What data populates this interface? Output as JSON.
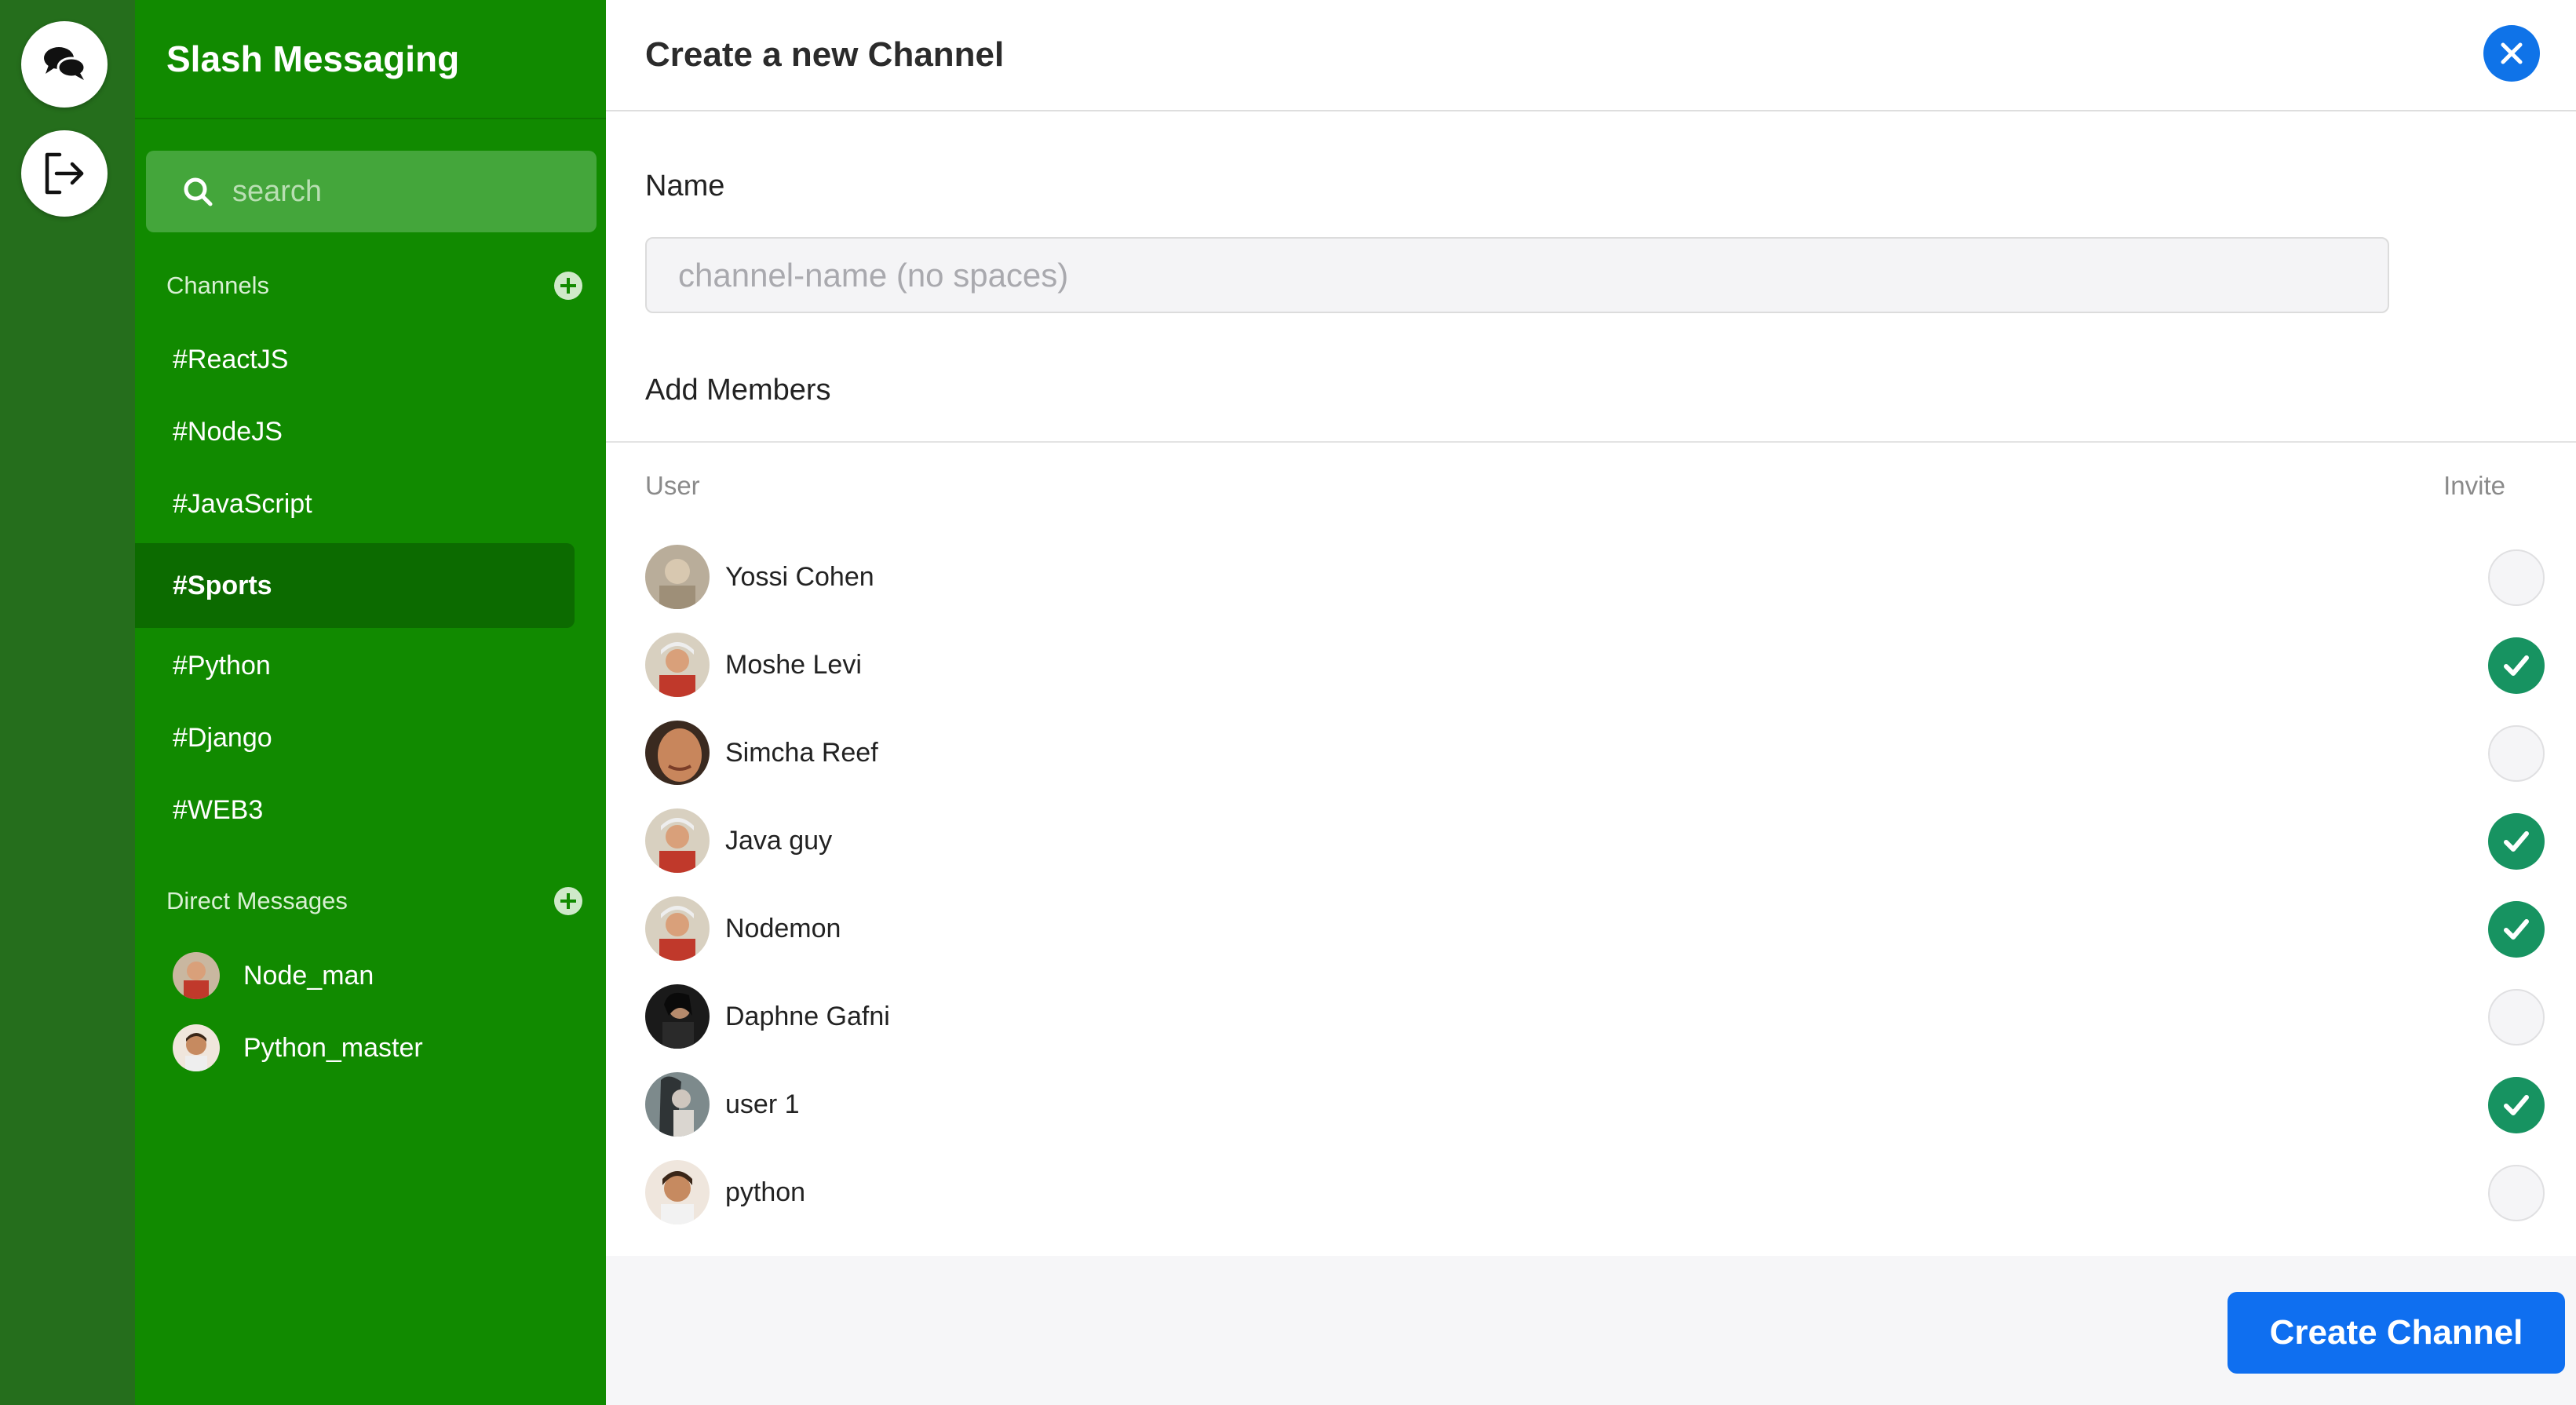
{
  "app": {
    "title": "Slash Messaging"
  },
  "rail": {
    "chat_icon": "chat-bubbles-icon",
    "logout_icon": "logout-icon"
  },
  "search": {
    "placeholder": "search"
  },
  "channels": {
    "heading": "Channels",
    "items": [
      {
        "label": "#ReactJS",
        "active": false
      },
      {
        "label": "#NodeJS",
        "active": false
      },
      {
        "label": "#JavaScript",
        "active": false
      },
      {
        "label": "#Sports",
        "active": true
      },
      {
        "label": "#Python",
        "active": false
      },
      {
        "label": "#Django",
        "active": false
      },
      {
        "label": "#WEB3",
        "active": false
      }
    ]
  },
  "direct_messages": {
    "heading": "Direct Messages",
    "items": [
      {
        "label": "Node_man"
      },
      {
        "label": "Python_master"
      }
    ]
  },
  "modal": {
    "title": "Create a new Channel",
    "name_label": "Name",
    "name_placeholder": "channel-name (no spaces)",
    "name_value": "",
    "members_label": "Add Members",
    "col_user": "User",
    "col_invite": "Invite",
    "members": [
      {
        "name": "Yossi Cohen",
        "invited": false
      },
      {
        "name": "Moshe Levi",
        "invited": true
      },
      {
        "name": "Simcha Reef",
        "invited": false
      },
      {
        "name": "Java guy",
        "invited": true
      },
      {
        "name": "Nodemon",
        "invited": true
      },
      {
        "name": "Daphne Gafni",
        "invited": false
      },
      {
        "name": "user 1",
        "invited": true
      },
      {
        "name": "python",
        "invited": false
      }
    ],
    "submit_label": "Create Channel"
  },
  "colors": {
    "rail": "#256e1c",
    "sidebar": "#118a00",
    "active_channel": "#0c6b00",
    "primary_button": "#0f6ff0",
    "invite_checked": "#179361"
  }
}
